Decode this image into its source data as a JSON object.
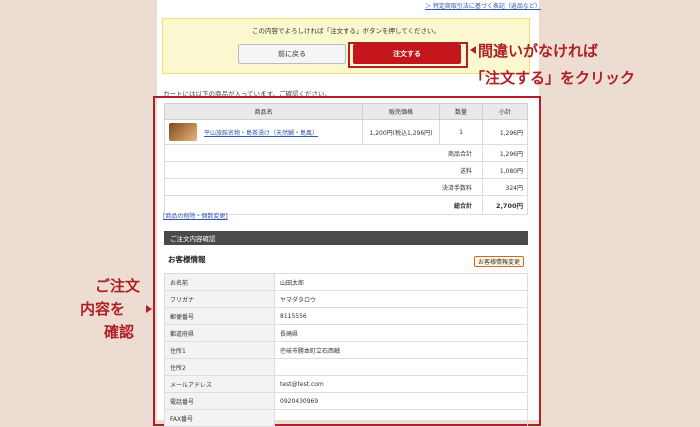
{
  "header": {
    "law_link": "＞ 特定商取引法に基づく表記（返品など）"
  },
  "confirm": {
    "message": "この内容でよろしければ「注文する」ボタンを押してください。",
    "back_label": "前に戻る",
    "order_label": "注文する"
  },
  "annotations": {
    "order_line1": "間違いがなければ",
    "order_line2": "「注文する」をクリック",
    "review_line1": "ご注文",
    "review_line2": "内容を",
    "review_line3": "確認"
  },
  "cart": {
    "note": "カートには以下の商品が入っています。ご確認ください。",
    "headers": [
      "商品名",
      "販売価格",
      "数量",
      "小計"
    ],
    "item": {
      "name": "平山旅館名物・島茶漬け（天然鯛・島風）",
      "price": "1,200円(税込1,296円)",
      "qty": "1",
      "subtotal": "1,296円"
    },
    "summary": [
      {
        "label": "商品合計",
        "value": "1,296円"
      },
      {
        "label": "送料",
        "value": "1,080円"
      },
      {
        "label": "決済手数料",
        "value": "324円"
      }
    ],
    "total_label": "総合計",
    "total_value": "2,700円",
    "edit_link": "[商品の削除・個数変更]"
  },
  "order_confirm": {
    "section_title": "ご注文内容確認",
    "customer_title": "お客様情報",
    "change_button": "お客様情報変更",
    "rows": [
      {
        "label": "お名前",
        "value": "山田太郎"
      },
      {
        "label": "フリガナ",
        "value": "ヤマダタロウ"
      },
      {
        "label": "郵便番号",
        "value": "8115556"
      },
      {
        "label": "都道府県",
        "value": "長崎県"
      },
      {
        "label": "住所1",
        "value": "壱岐市勝本町立石西触"
      },
      {
        "label": "住所2",
        "value": ""
      },
      {
        "label": "メールアドレス",
        "value": "test@test.com"
      },
      {
        "label": "電話番号",
        "value": "0920430969"
      },
      {
        "label": "FAX番号",
        "value": ""
      }
    ]
  },
  "colors": {
    "accent": "#c4161c",
    "annotation": "#b01f25",
    "background": "#ecdcd2"
  }
}
